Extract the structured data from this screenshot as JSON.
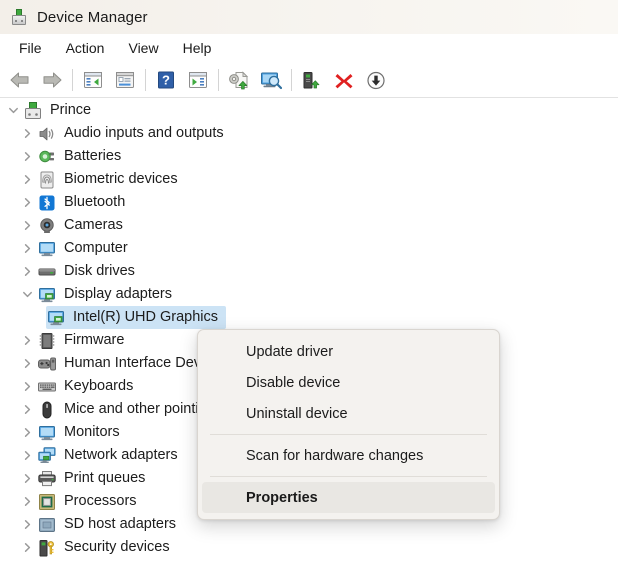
{
  "window": {
    "title": "Device Manager",
    "title_icon": "device-manager-icon"
  },
  "menubar": {
    "items": [
      {
        "label": "File",
        "name": "menu-file"
      },
      {
        "label": "Action",
        "name": "menu-action"
      },
      {
        "label": "View",
        "name": "menu-view"
      },
      {
        "label": "Help",
        "name": "menu-help"
      }
    ]
  },
  "toolbar": {
    "buttons": [
      {
        "icon": "back-arrow-icon",
        "name": "toolbar-back"
      },
      {
        "icon": "forward-arrow-icon",
        "name": "toolbar-forward"
      },
      {
        "icon": "show-hidden-devices-icon",
        "name": "toolbar-show-hidden-devices"
      },
      {
        "icon": "properties-icon",
        "name": "toolbar-properties"
      },
      {
        "icon": "help-icon",
        "name": "toolbar-help"
      },
      {
        "icon": "view-devices-icon",
        "name": "toolbar-view-devices"
      },
      {
        "icon": "update-driver-icon",
        "name": "toolbar-update-driver"
      },
      {
        "icon": "scan-for-hardware-changes-icon",
        "name": "toolbar-scan-hardware"
      },
      {
        "icon": "add-legacy-hardware-icon",
        "name": "toolbar-add-legacy-hardware"
      },
      {
        "icon": "uninstall-device-icon",
        "name": "toolbar-uninstall-device"
      },
      {
        "icon": "disable-device-icon",
        "name": "toolbar-disable-device"
      }
    ]
  },
  "tree": {
    "nodes": [
      {
        "label": "Prince",
        "level": 0,
        "expanded": true,
        "has_children": true,
        "icon": "computer-root-icon",
        "selected": false
      },
      {
        "label": "Audio inputs and outputs",
        "level": 1,
        "expanded": false,
        "has_children": true,
        "icon": "speaker-icon",
        "selected": false
      },
      {
        "label": "Batteries",
        "level": 1,
        "expanded": false,
        "has_children": true,
        "icon": "battery-icon",
        "selected": false
      },
      {
        "label": "Biometric devices",
        "level": 1,
        "expanded": false,
        "has_children": true,
        "icon": "fingerprint-icon",
        "selected": false
      },
      {
        "label": "Bluetooth",
        "level": 1,
        "expanded": false,
        "has_children": true,
        "icon": "bluetooth-icon",
        "selected": false
      },
      {
        "label": "Cameras",
        "level": 1,
        "expanded": false,
        "has_children": true,
        "icon": "camera-icon",
        "selected": false
      },
      {
        "label": "Computer",
        "level": 1,
        "expanded": false,
        "has_children": true,
        "icon": "monitor-icon",
        "selected": false
      },
      {
        "label": "Disk drives",
        "level": 1,
        "expanded": false,
        "has_children": true,
        "icon": "disk-drive-icon",
        "selected": false
      },
      {
        "label": "Display adapters",
        "level": 1,
        "expanded": true,
        "has_children": true,
        "icon": "display-adapter-icon",
        "selected": false
      },
      {
        "label": "Intel(R) UHD Graphics",
        "level": 2,
        "expanded": false,
        "has_children": false,
        "icon": "display-adapter-icon",
        "selected": true
      },
      {
        "label": "Firmware",
        "level": 1,
        "expanded": false,
        "has_children": true,
        "icon": "firmware-chip-icon",
        "selected": false
      },
      {
        "label": "Human Interface Devices",
        "level": 1,
        "expanded": false,
        "has_children": true,
        "icon": "human-interface-icon",
        "selected": false
      },
      {
        "label": "Keyboards",
        "level": 1,
        "expanded": false,
        "has_children": true,
        "icon": "keyboard-icon",
        "selected": false
      },
      {
        "label": "Mice and other pointing devices",
        "level": 1,
        "expanded": false,
        "has_children": true,
        "icon": "mouse-icon",
        "selected": false
      },
      {
        "label": "Monitors",
        "level": 1,
        "expanded": false,
        "has_children": true,
        "icon": "monitor-icon",
        "selected": false
      },
      {
        "label": "Network adapters",
        "level": 1,
        "expanded": false,
        "has_children": true,
        "icon": "network-adapter-icon",
        "selected": false
      },
      {
        "label": "Print queues",
        "level": 1,
        "expanded": false,
        "has_children": true,
        "icon": "printer-icon",
        "selected": false
      },
      {
        "label": "Processors",
        "level": 1,
        "expanded": false,
        "has_children": true,
        "icon": "processor-icon",
        "selected": false
      },
      {
        "label": "SD host adapters",
        "level": 1,
        "expanded": false,
        "has_children": true,
        "icon": "sd-host-adapter-icon",
        "selected": false
      },
      {
        "label": "Security devices",
        "level": 1,
        "expanded": false,
        "has_children": true,
        "icon": "security-device-icon",
        "selected": false
      }
    ]
  },
  "context_menu": {
    "items": [
      {
        "label": "Update driver",
        "name": "ctx-update-driver",
        "highlight": false,
        "separator_after": false
      },
      {
        "label": "Disable device",
        "name": "ctx-disable-device",
        "highlight": false,
        "separator_after": false
      },
      {
        "label": "Uninstall device",
        "name": "ctx-uninstall-device",
        "highlight": false,
        "separator_after": true
      },
      {
        "label": "Scan for hardware changes",
        "name": "ctx-scan-hardware",
        "highlight": false,
        "separator_after": true
      },
      {
        "label": "Properties",
        "name": "ctx-properties",
        "highlight": true,
        "separator_after": false
      }
    ]
  },
  "colors": {
    "selection": "#cce3f5",
    "menu_highlight": "#e9e7e3",
    "titlebar": "#f6f3ee",
    "accent_blue": "#0078d4",
    "uninstall_red": "#e02020",
    "green": "#3ea83e"
  }
}
